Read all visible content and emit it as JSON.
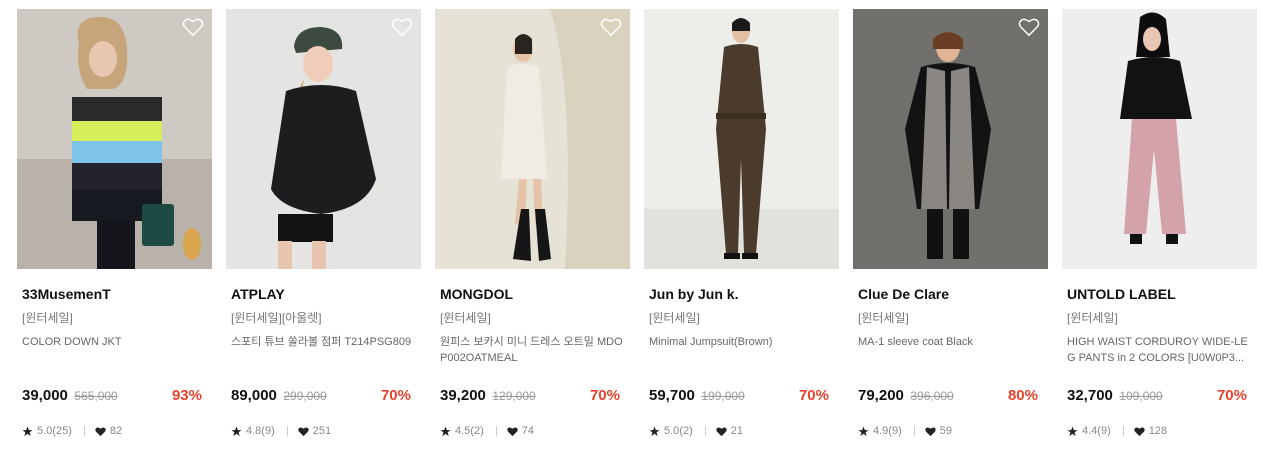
{
  "colors": {
    "discount": "#e8412c",
    "text": "#111111",
    "muted": "#888888"
  },
  "products": [
    {
      "brand": "33MusemenT",
      "tag": "[윈터세일]",
      "name": "COLOR DOWN JKT",
      "price": "39,000",
      "original_price": "565,000",
      "discount": "93%",
      "rating": "5.0(25)",
      "likes": "82",
      "image": "woman in striped puffer down jacket with bag"
    },
    {
      "brand": "ATPLAY",
      "tag": "[윈터세일][아울렛]",
      "name": "스포티 튜브 쏠라볼 점퍼 T214PSG809",
      "price": "89,000",
      "original_price": "299,000",
      "discount": "70%",
      "rating": "4.8(9)",
      "likes": "251",
      "image": "woman in black quilted jacket and cap"
    },
    {
      "brand": "MONGDOL",
      "tag": "[윈터세일]",
      "name": "원피스 보카시 미니 드레스 오트밀 MDOP002OATMEAL",
      "price": "39,200",
      "original_price": "129,000",
      "discount": "70%",
      "rating": "4.5(2)",
      "likes": "74",
      "image": "woman in oatmeal mini dress with boots"
    },
    {
      "brand": "Jun by Jun k.",
      "tag": "[윈터세일]",
      "name": "Minimal Jumpsuit(Brown)",
      "price": "59,700",
      "original_price": "199,000",
      "discount": "70%",
      "rating": "5.0(2)",
      "likes": "21",
      "image": "woman in brown jumpsuit"
    },
    {
      "brand": "Clue De Clare",
      "tag": "[윈터세일]",
      "name": "MA-1 sleeve coat Black",
      "price": "79,200",
      "original_price": "396,000",
      "discount": "80%",
      "rating": "4.9(9)",
      "likes": "59",
      "image": "woman in tweed sleeve coat and boots"
    },
    {
      "brand": "UNTOLD LABEL",
      "tag": "[윈터세일]",
      "name": "HIGH WAIST CORDUROY WIDE-LEG PANTS in 2 COLORS [U0W0P3...",
      "price": "32,700",
      "original_price": "109,000",
      "discount": "70%",
      "rating": "4.4(9)",
      "likes": "128",
      "image": "woman in pink corduroy wide pants"
    }
  ]
}
